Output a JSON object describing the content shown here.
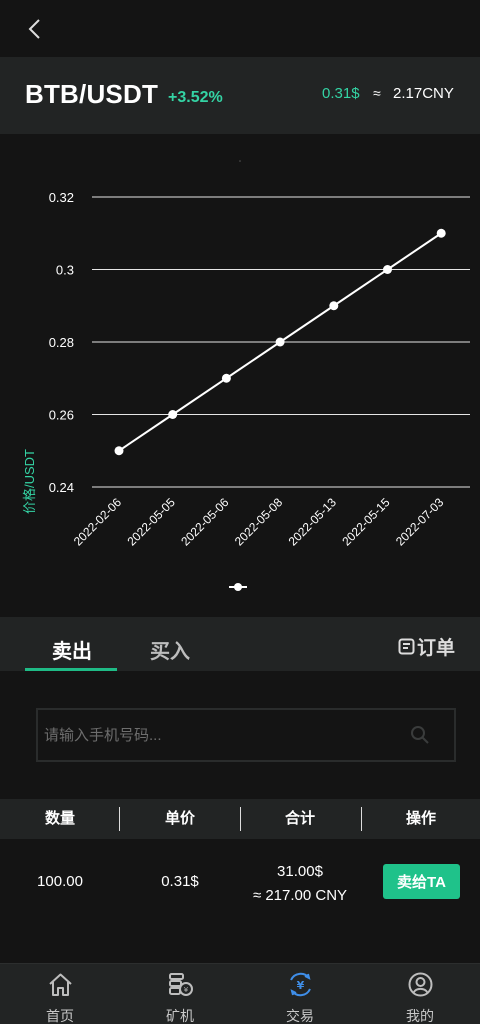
{
  "header": {
    "back_icon": "chevron-left-icon"
  },
  "pair": {
    "name": "BTB/USDT",
    "change": "+3.52%",
    "price_usd": "0.31$",
    "approx": "≈",
    "price_cny": "2.17CNY",
    "accent_color": "#34d3a4"
  },
  "chart_data": {
    "type": "line",
    "x": [
      "2022-02-06",
      "2022-05-05",
      "2022-05-06",
      "2022-05-08",
      "2022-05-13",
      "2022-05-15",
      "2022-07-03"
    ],
    "series": [
      {
        "values": [
          0.25,
          0.26,
          0.27,
          0.28,
          0.29,
          0.3,
          0.31
        ]
      }
    ],
    "ylabel": "价格/USDT",
    "yticks": [
      "0.32",
      "0.3",
      "0.28",
      "0.26",
      "0.24"
    ],
    "ylim": [
      0.24,
      0.32
    ],
    "grid": true,
    "legend": "bottom-center",
    "line_color": "#ffffff"
  },
  "tabs": {
    "sell": "卖出",
    "buy": "买入",
    "orders": "订单",
    "orders_icon": "document-icon",
    "active_color": "#1fbb86"
  },
  "search": {
    "placeholder": "请输入手机号码...",
    "value": "",
    "icon": "search-icon"
  },
  "table": {
    "headers": [
      "数量",
      "单价",
      "合计",
      "操作"
    ],
    "rows": [
      {
        "quantity": "100.00",
        "unit_price": "0.31$",
        "total_usd": "31.00$",
        "total_cny": "≈  217.00 CNY",
        "action": "卖给TA"
      }
    ],
    "button_color": "#1fc28a"
  },
  "nav": {
    "items": [
      {
        "label": "首页",
        "icon": "home-icon"
      },
      {
        "label": "矿机",
        "icon": "mining-machine-icon"
      },
      {
        "label": "交易",
        "icon": "trade-yuan-icon"
      },
      {
        "label": "我的",
        "icon": "user-icon"
      }
    ],
    "active_index": 2,
    "active_color": "#3f8ee8"
  }
}
